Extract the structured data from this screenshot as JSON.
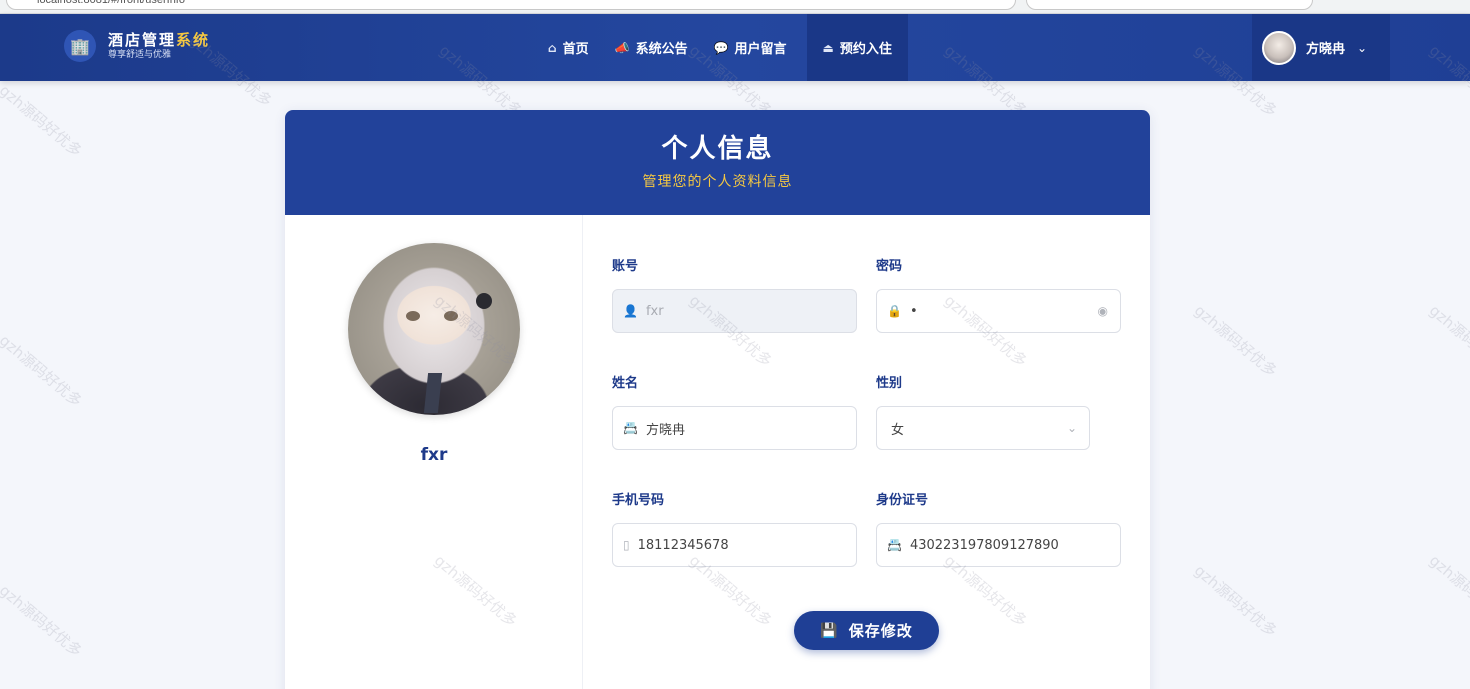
{
  "browser": {
    "url": "localhost:8081/#/front/userInfo"
  },
  "nav": {
    "brand_title_a": "酒店管理",
    "brand_title_b": "系统",
    "brand_subtitle": "尊享舒适与优雅",
    "items": [
      {
        "label": "首页",
        "icon": "home-icon",
        "glyph": "⌂"
      },
      {
        "label": "系统公告",
        "icon": "megaphone-icon",
        "glyph": "📢"
      },
      {
        "label": "用户留言",
        "icon": "chat-icon",
        "glyph": "💬"
      },
      {
        "label": "预约入住",
        "icon": "eject-icon",
        "glyph": "⏏"
      }
    ],
    "user_name": "方晓冉"
  },
  "card": {
    "title": "个人信息",
    "subtitle": "管理您的个人资料信息",
    "username_display": "fxr"
  },
  "form": {
    "account": {
      "label": "账号",
      "value": "fxr"
    },
    "password": {
      "label": "密码",
      "value": "•"
    },
    "name": {
      "label": "姓名",
      "value": "方晓冉"
    },
    "gender": {
      "label": "性别",
      "value": "女"
    },
    "phone": {
      "label": "手机号码",
      "value": "18112345678"
    },
    "id_card": {
      "label": "身份证号",
      "value": "430223197809127890"
    },
    "save_label": "保存修改"
  },
  "watermark": "gzh源码好优多",
  "colors": {
    "primary": "#22429a",
    "accent": "#f5c842",
    "page_bg": "#f4f6fb"
  }
}
